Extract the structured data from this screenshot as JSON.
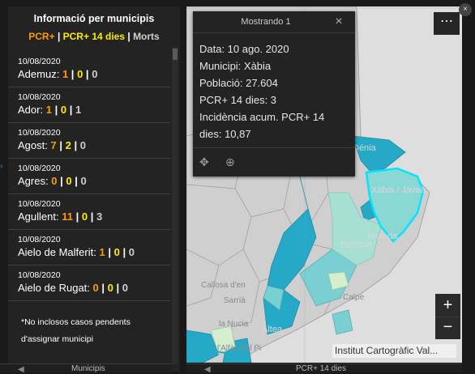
{
  "left_panel": {
    "title": "Informació per municipis",
    "subtitle": {
      "a": "PCR+",
      "b": "PCR+ 14 dies",
      "c": "Morts",
      "sep": "|"
    },
    "items": [
      {
        "date": "10/08/2020",
        "name": "Ademuz:",
        "pcr": "1",
        "pcr14": "0",
        "morts": "0"
      },
      {
        "date": "10/08/2020",
        "name": "Ador:",
        "pcr": "1",
        "pcr14": "0",
        "morts": "1"
      },
      {
        "date": "10/08/2020",
        "name": "Agost:",
        "pcr": "7",
        "pcr14": "2",
        "morts": "0"
      },
      {
        "date": "10/08/2020",
        "name": "Agres:",
        "pcr": "0",
        "pcr14": "0",
        "morts": "0"
      },
      {
        "date": "10/08/2020",
        "name": "Agullent:",
        "pcr": "11",
        "pcr14": "0",
        "morts": "3"
      },
      {
        "date": "10/08/2020",
        "name": "Aielo de Malferit:",
        "pcr": "1",
        "pcr14": "0",
        "morts": "0"
      },
      {
        "date": "10/08/2020",
        "name": "Aielo de Rugat:",
        "pcr": "0",
        "pcr14": "0",
        "morts": "0"
      }
    ],
    "footnote_1": "*No inclosos casos pendents",
    "footnote_2": "d'assignar municipi",
    "tab_label": "Municipis"
  },
  "popup": {
    "title": "Mostrando 1",
    "lines": [
      "Data: 10 ago. 2020",
      "Municipi: Xàbia",
      "Població: 27.604",
      "PCR+ 14 dies: 3",
      "Incidència acum. PCR+ 14",
      "dies: 10,87"
    ]
  },
  "map": {
    "places": {
      "denia": "Dénia",
      "xabia": "Xàbia / Jávea",
      "benissa": "Benissa",
      "teulada": "Teulada",
      "calpe": "Calpe",
      "callosa": "Callosa d'en",
      "sarria": "Sarrià",
      "nucia": "la Nucia",
      "altea": "Altea",
      "alfas": "l'Alfàs del Pi"
    },
    "attribution": "Institut Cartogràfic Val...",
    "tab_label": "PCR+ 14 dies",
    "colors": {
      "teal_dark": "#25a9c7",
      "teal_mid": "#79cfd1",
      "teal_light": "#a8dfd3",
      "pale_green": "#d4efd0",
      "land": "#cccccc",
      "sea": "#dedede",
      "highlight": "#00e5ff"
    }
  },
  "controls": {
    "menu": "⋯",
    "zoom_in": "+",
    "zoom_out": "−",
    "close": "×"
  }
}
